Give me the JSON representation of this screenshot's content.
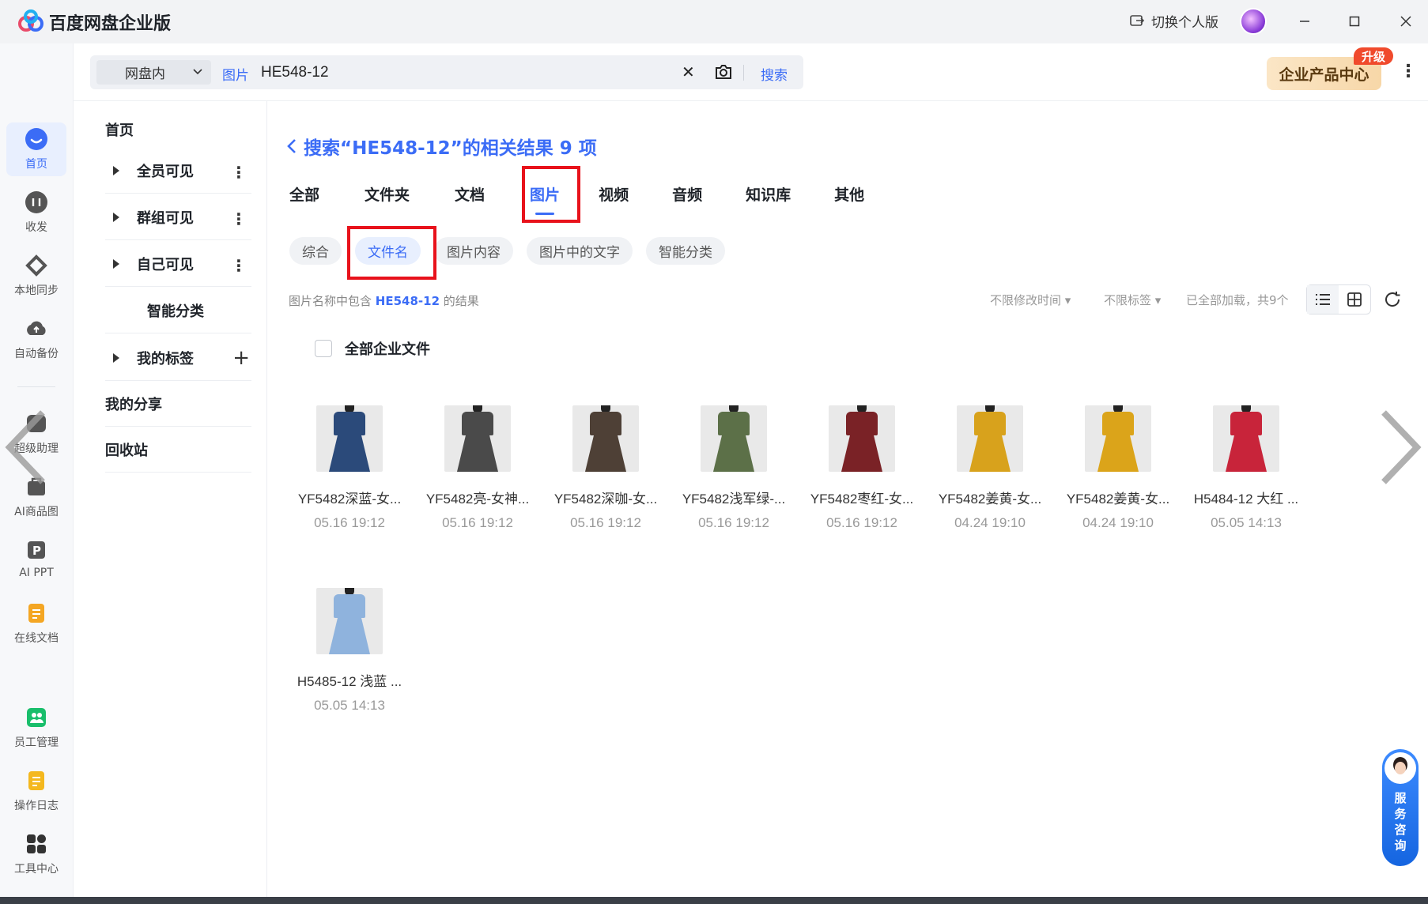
{
  "app": {
    "title": "百度网盘企业版",
    "switch_personal": "切换个人版"
  },
  "search": {
    "scope": "网盘内",
    "type": "图片",
    "query": "HE548-12",
    "button": "搜索"
  },
  "header": {
    "product_center": "企业产品中心",
    "upgrade_badge": "升级"
  },
  "rail": [
    {
      "label": "首页",
      "icon": "home-icon"
    },
    {
      "label": "收发",
      "icon": "transfer-icon"
    },
    {
      "label": "本地同步",
      "icon": "sync-icon"
    },
    {
      "label": "自动备份",
      "icon": "backup-icon"
    },
    {
      "label": "超级助理",
      "icon": "assistant-icon"
    },
    {
      "label": "AI商品图",
      "icon": "ai-product-image-icon"
    },
    {
      "label": "AI PPT",
      "icon": "ai-ppt-icon"
    },
    {
      "label": "在线文档",
      "icon": "online-doc-icon"
    },
    {
      "label": "员工管理",
      "icon": "staff-icon"
    },
    {
      "label": "操作日志",
      "icon": "log-icon"
    },
    {
      "label": "工具中心",
      "icon": "tools-icon"
    }
  ],
  "secnav": {
    "home": "首页",
    "all_visible": "全员可见",
    "group_visible": "群组可见",
    "self_visible": "自己可见",
    "smart_category": "智能分类",
    "my_tags": "我的标签",
    "my_shares": "我的分享",
    "recycle_bin": "回收站"
  },
  "results": {
    "title": "搜索“HE548-12”的相关结果 9 项",
    "tabs": [
      "全部",
      "文件夹",
      "文档",
      "图片",
      "视频",
      "音频",
      "知识库",
      "其他"
    ],
    "active_tab": "图片",
    "chips": [
      "综合",
      "文件名",
      "图片内容",
      "图片中的文字",
      "智能分类"
    ],
    "active_chip": "文件名",
    "filter_prefix": "图片名称中包含",
    "filter_keyword": "HE548-12",
    "filter_suffix": "的结果",
    "sort_time": "不限修改时间",
    "sort_tag": "不限标签",
    "load_status": "已全部加载，共9个",
    "select_all": "全部企业文件",
    "files": [
      {
        "name": "YF5482深蓝-女...",
        "date": "05.16 19:12",
        "color": "#2b4a7a"
      },
      {
        "name": "YF5482亮-女神...",
        "date": "05.16 19:12",
        "color": "#4a4a4a"
      },
      {
        "name": "YF5482深咖-女...",
        "date": "05.16 19:12",
        "color": "#4e4036"
      },
      {
        "name": "YF5482浅军绿-...",
        "date": "05.16 19:12",
        "color": "#5c7048"
      },
      {
        "name": "YF5482枣红-女...",
        "date": "05.16 19:12",
        "color": "#7a2226"
      },
      {
        "name": "YF5482姜黄-女...",
        "date": "04.24 19:10",
        "color": "#d8a21c"
      },
      {
        "name": "YF5482姜黄-女...",
        "date": "04.24 19:10",
        "color": "#dba41a"
      },
      {
        "name": "H5484-12 大红 ...",
        "date": "05.05 14:13",
        "color": "#c8243a"
      },
      {
        "name": "H5485-12 浅蓝 ...",
        "date": "05.05 14:13",
        "color": "#8fb3dd"
      }
    ]
  },
  "service": {
    "label": "服务咨询"
  }
}
